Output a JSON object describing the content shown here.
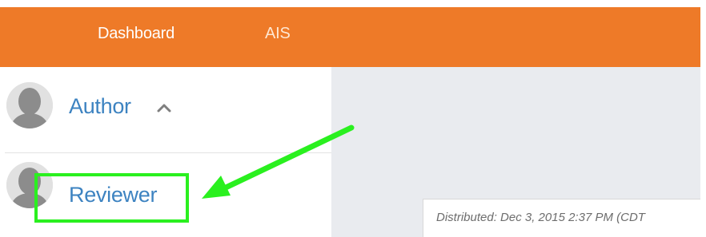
{
  "topnav": {
    "items": [
      {
        "label": "Dashboard"
      },
      {
        "label": "AIS"
      }
    ]
  },
  "sidebar": {
    "items": [
      {
        "label": "Author",
        "icon": "chevron-up-icon"
      },
      {
        "label": "Reviewer"
      }
    ]
  },
  "main": {
    "card": {
      "distributed": "Distributed:  Dec 3, 2015 2:37 PM (CDT"
    }
  },
  "colors": {
    "topbar": "#ee7a28",
    "link": "#3d83c1",
    "highlight": "#2af01f",
    "main_background": "#e9ebef"
  }
}
